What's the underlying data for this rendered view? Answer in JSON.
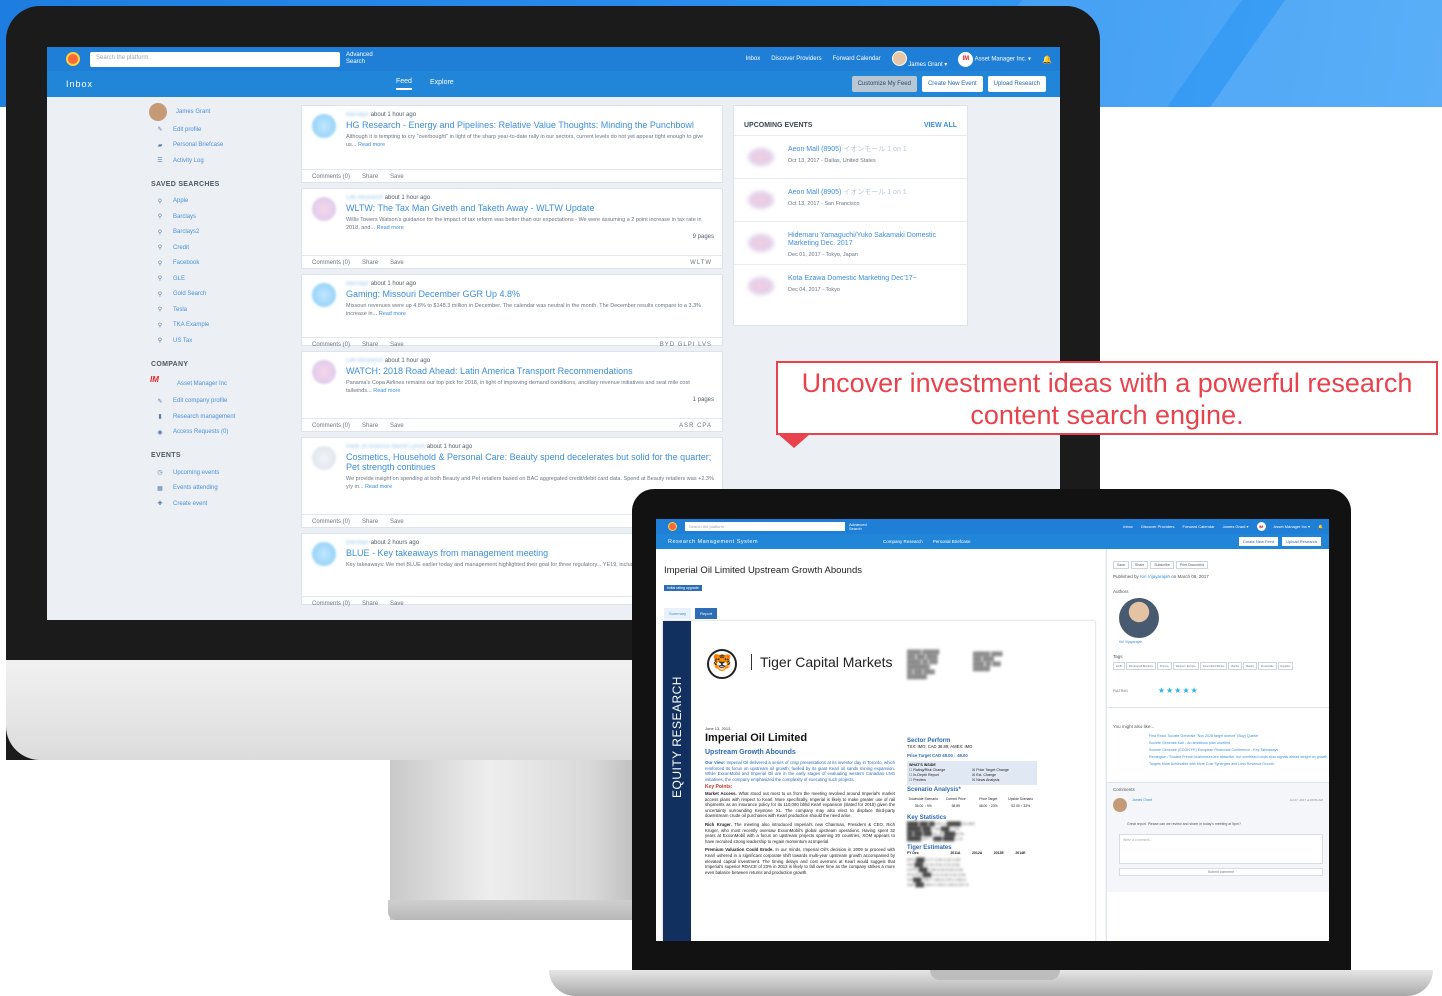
{
  "callout": {
    "text": "Uncover investment ideas with a powerful research content search engine."
  },
  "desktop": {
    "search_placeholder": "Search the platform",
    "advanced_search": "Advanced Search",
    "nav": [
      "Inbox",
      "Discover Providers",
      "Forward Calendar"
    ],
    "user": "James Grant ▾",
    "org": "Asset Manager Inc. ▾",
    "org_badge": "IM",
    "page_title": "Inbox",
    "tabs": [
      "Feed",
      "Explore"
    ],
    "buttons": [
      "Customize My Feed",
      "Create New Event",
      "Upload Research"
    ],
    "profile": {
      "name": "James Grant",
      "links": [
        "Edit profile",
        "Personal Briefcase",
        "Activity Log"
      ]
    },
    "saved_searches_heading": "SAVED SEARCHES",
    "saved_searches": [
      "Apple",
      "Barclays",
      "Barclays2",
      "Credit",
      "Facebook",
      "GLE",
      "Gold Search",
      "Tesla",
      "TKA Example",
      "US Tax"
    ],
    "company_heading": "COMPANY",
    "company": {
      "name": "Asset Manager Inc",
      "logo": "IM",
      "links": [
        "Edit company profile",
        "Research management",
        "Access Requests (0)"
      ]
    },
    "events_heading": "EVENTS",
    "events_links": [
      "Upcoming events",
      "Events attending",
      "Create event"
    ],
    "feed": [
      {
        "source": "Barclays",
        "time": "about 1 hour ago",
        "title": "HG Research - Energy and Pipelines: Relative Value Thoughts: Minding the Punchbowl",
        "text": "Although it is tempting to cry \"overbought\" in light of the sharp year-to-date rally in our sectors, current levels do not yet appear tight enough to give us...",
        "more": "Read more",
        "pages": "",
        "tags": "",
        "thumb": "blue"
      },
      {
        "source": "Life Research",
        "time": "about 1 hour ago",
        "title": "WLTW: The Tax Man Giveth and Taketh Away - WLTW Update",
        "text": "Willis Towers Watson's guidance for the impact of tax reform was better than our expectations - We were assuming a 2 point increase in tax rate in 2018, and...",
        "more": "Read more",
        "pages": "9 pages",
        "tags": "WLTW",
        "thumb": "pink"
      },
      {
        "source": "Barclays",
        "time": "about 1 hour ago",
        "title": "Gaming: Missouri December GGR Up 4.8%",
        "text": "Missouri revenues were up 4.8% to $148.3 million in December. The calendar was neutral in the month. The December results compare to a 3.3% increase in...",
        "more": "Read more",
        "pages": "",
        "tags": "BYD  GLPI  LVS",
        "thumb": "blue"
      },
      {
        "source": "Life Research",
        "time": "about 1 hour ago",
        "title": "WATCH: 2018 Road Ahead: Latin America Transport Recommendations",
        "text": "Panama's Copa Airlines remains our top pick for 2018, in light of improving demand conditions, ancillary revenue initiatives and seat mile cost tailwinds...",
        "more": "Read more",
        "pages": "1 pages",
        "tags": "ASR  CPA",
        "thumb": "pink"
      },
      {
        "source": "Bank of America Merrill Lynch",
        "time": "about 1 hour ago",
        "title": "Cosmetics, Household & Personal Care: Beauty spend decelerates but solid for the quarter; Pet strength continues",
        "text": "We provide insight on spending at both Beauty and Pet retailers based on BAC aggregated credit/debit card data. Spend at Beauty retailers was +2.3% y/y in...",
        "more": "Read more",
        "pages": "",
        "tags": "",
        "thumb": "grey"
      },
      {
        "source": "Barclays",
        "time": "about 2 hours ago",
        "title": "BLUE - Key takeaways from management meeting",
        "text": "Key takeaways: We met BLUE earlier today and management highlighted their goal for three regulatory... YE19, including LentiGlobin in...",
        "more": "Read more",
        "pages": "",
        "tags": "",
        "thumb": "blue"
      }
    ],
    "card_actions": [
      "Comments (0)",
      "Share",
      "Save"
    ],
    "upcoming": {
      "heading": "UPCOMING EVENTS",
      "view_all": "VIEW ALL",
      "items": [
        {
          "title": "Aeon Mall (8905)",
          "jp": "イオンモール 1 on 1",
          "date": "Oct 13, 2017 - Dallas, United States"
        },
        {
          "title": "Aeon Mall (8905)",
          "jp": "イオンモール 1 on 1",
          "date": "Oct 13, 2017 - San Francisco"
        },
        {
          "title": "Hidemaru Yamaguchi/Yuko Sakamaki Domestic Marketing Dec. 2017",
          "jp": "",
          "date": "Dec 01, 2017 - Tokyo, Japan"
        },
        {
          "title": "Kota Ezawa Domestic Marketing Dec'17~",
          "jp": "",
          "date": "Dec 04, 2017 - Tokyo"
        }
      ]
    }
  },
  "laptop": {
    "search_placeholder": "Search the platform",
    "advanced_search": "Advanced Search",
    "nav": [
      "Inbox",
      "Discover Providers",
      "Forward Calendar",
      "James Grant ▾",
      "Asset Manager Inc ▾"
    ],
    "org_badge": "IM",
    "system_title": "Research Management System",
    "subnav": [
      "Company Research",
      "Personal Briefcase"
    ],
    "buttons": [
      "Create New Feed",
      "Upload Research"
    ],
    "doc_title": "Imperial Oil Limited Upstream Growth Abounds",
    "doc_badge": "Initial rating upgrade",
    "doc_tabs": [
      "Summary",
      "Report"
    ],
    "report": {
      "spine": "EQUITY RESEARCH",
      "brand": "Tiger Capital Markets",
      "date": "June 13, 2013",
      "company": "Imperial Oil Limited",
      "subtitle": "Upstream Growth Abounds",
      "our_view_label": "Our View:",
      "our_view": "Imperial Oil delivered a series of crisp presentations at its investor day in Toronto, which reinforced its focus on upstream oil growth, fuelled by its giant Kearl oil sands mining expansion. While ExxonMobil and Imperial Oil are in the early stages of evaluating western Canadian LNG initiatives, the company emphasized the complexity of executing such projects.",
      "key_points": "Key Points:",
      "kp1_label": "Market Access.",
      "kp1": "What stood out most to us from the meeting revolved around Imperial's market access plans with respect to Kearl. More specifically, Imperial is likely to make greater use of rail shipments as an insurance policy for its 110,000 bbl/d Kearl expansion (slated for 2015) given the uncertainty surrounding Keystone XL. The company may also elect to displace third-party downstream crude oil purchases with Kearl production should the need arise.",
      "kp2_label": "Rich Kruger.",
      "kp2": "The meeting also introduced Imperial's new Chairman, President & CEO, Rich Kruger, who most recently oversaw ExxonMobil's global upstream operations. Having spent 32 years at ExxonMobil with a focus on upstream projects spanning 20 countries, XOM appears to have recruited strong leadership to regain momentum at Imperial.",
      "kp3_label": "Premium Valuation Could Erode.",
      "kp3": "In our minds, Imperial Oil's decision in 2009 to proceed with Kearl ushered in a significant corporate shift towards multi-year upstream growth accompanied by elevated capital investment. The timing delays and cost overruns at Kearl would suggest that Imperial's superior ROACE of 23% in 2012 is likely to fall over time as the company strikes a more even balance between returns and production growth.",
      "sector": "Sector Perform",
      "tsx": "TSX: IMO; CAD 38.89; AMEX: IMO",
      "price_target": "Price Target CAD 48.00 ↓ 49.00",
      "whats_inside": "WHAT'S INSIDE",
      "inside_items": [
        "Rating/Risk Change",
        "Price Target Change",
        "In-Depth Report",
        "Est. Change",
        "Preview",
        "News Analysis"
      ],
      "scenario": "Scenario Analysis*",
      "scenario_cols": [
        "Downside Scenario",
        "Current Price",
        "Price Target",
        "Upside Scenario"
      ],
      "scenario_vals": [
        "35.00 ↓ 9%",
        "38.89",
        "48.00 ↑ 23%",
        "52.00 ↑ 33%"
      ],
      "key_stats": "Key Statistics",
      "tiger_est": "Tiger Estimates",
      "est_cols": [
        "FY Dec",
        "2011A",
        "2012A",
        "2013E",
        "2014E"
      ]
    },
    "side": {
      "actions": [
        "Save",
        "Share",
        "Subscribe",
        "Print Document"
      ],
      "published_prefix": "Published by",
      "published_by": "Kiri Vijayarajah",
      "published_suffix": "on March 08, 2017",
      "authors_label": "Authors",
      "author": "Kiri Vijayarajah",
      "tags_label": "Tags",
      "tags": [
        "ECB",
        "Developed Markets",
        "France",
        "Western Europe",
        "Diversified Banks",
        "Banks",
        "Banks",
        "Financials",
        "Equities"
      ],
      "rating_label": "RATING",
      "stars": "★★★★★",
      "also_like": "You might also like...",
      "links": [
        "First Read: Societe Generale \"Nov 2028 target doesnt\" (Buy) Quintet",
        "Societe Generale Karl - An ambitious plan unveiled",
        "Societe Generale (GGGN FK) European Financials Conference - Key Takeaways",
        "Remington / Societe French businesses are attractive, but overheard costs slow signals ahead weight on growth",
        "Targets More Achievable with More Cost Synergies and Less Revenue Growth"
      ],
      "comments_label": "Comments",
      "comment_name": "James Grant",
      "comment_date": "Jul 07, 2017 at 09:56 AM",
      "comment_text": "Great report. Please can we review and share in today's meeting at 5pm?",
      "comment_placeholder": "Write a comment...",
      "submit": "Submit comment"
    }
  }
}
